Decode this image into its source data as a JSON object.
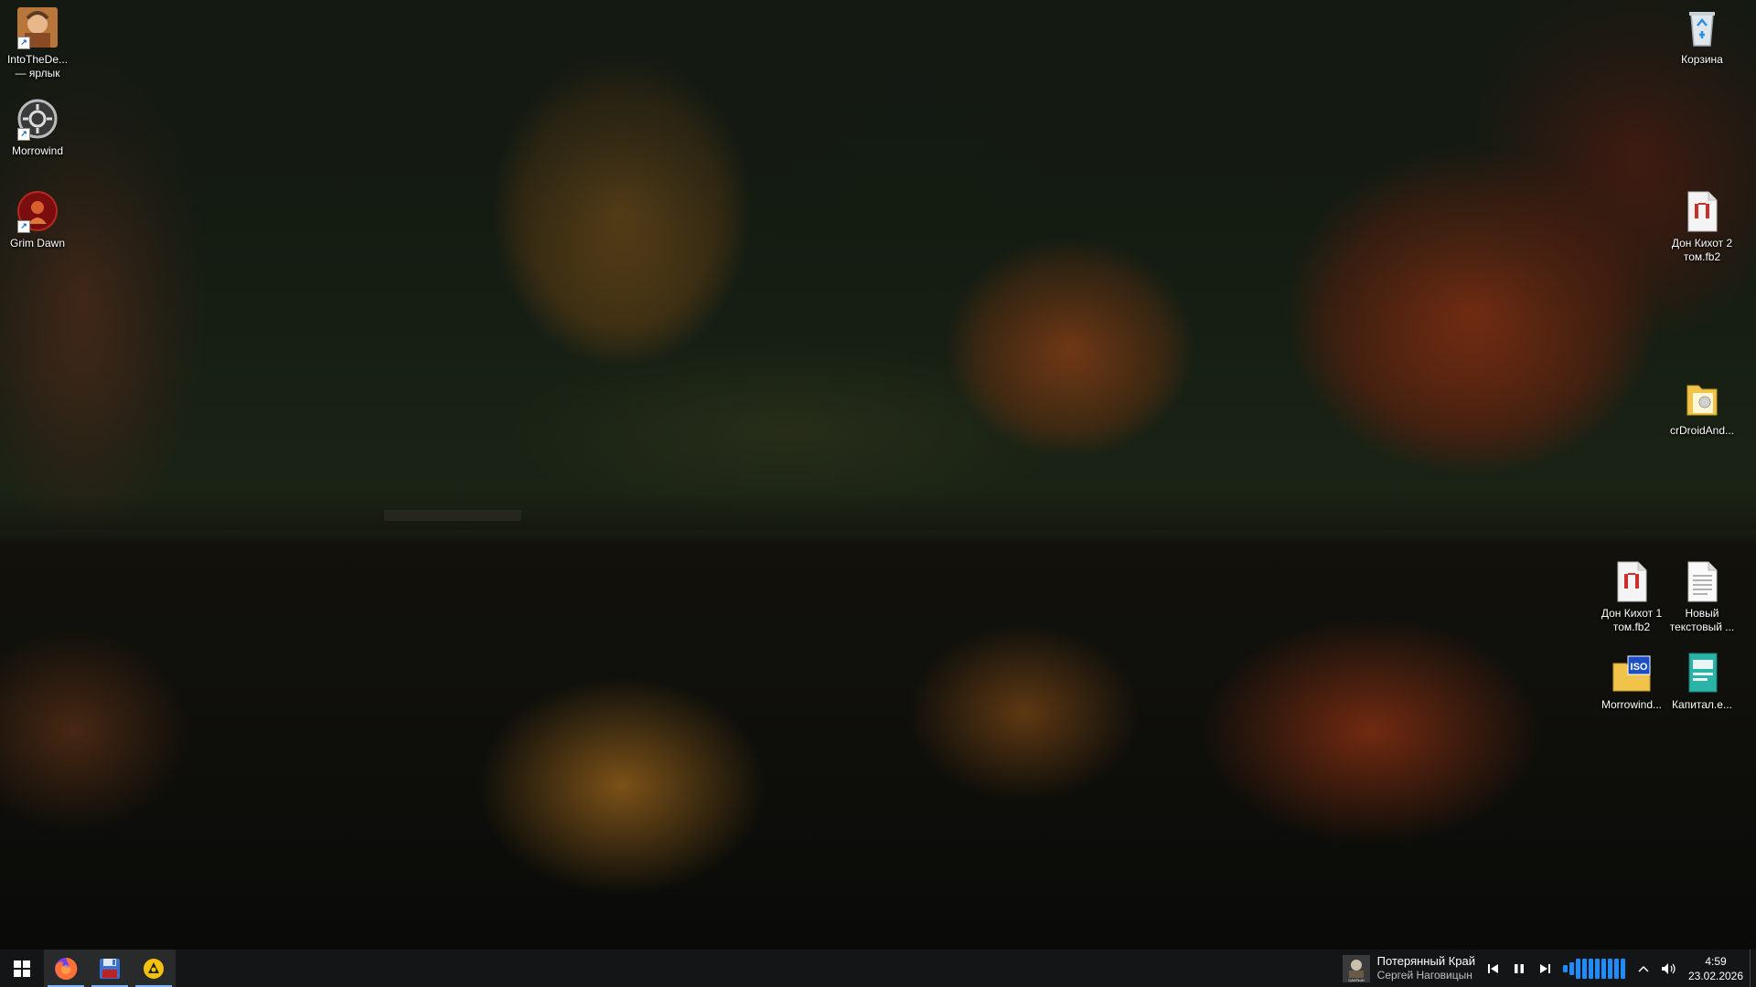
{
  "desktop": {
    "left_icons": [
      {
        "label": "IntoTheDe... — ярлык",
        "icon": "game-portrait-icon"
      },
      {
        "label": "Morrowind",
        "icon": "morrowind-gear-icon"
      },
      {
        "label": "Grim Dawn",
        "icon": "grim-dawn-icon"
      }
    ],
    "right_icons": [
      {
        "label": "Корзина",
        "icon": "recycle-bin-icon"
      },
      {
        "label": "Дон Кихот 2 том.fb2",
        "icon": "fb2-document-icon"
      },
      {
        "label": "crDroidAnd...",
        "icon": "zip-archive-icon"
      },
      {
        "label": "Дон Кихот 1 том.fb2",
        "icon": "fb2-document-icon"
      },
      {
        "label": "Новый текстовый ...",
        "icon": "text-document-icon"
      },
      {
        "label": "Morrowind...",
        "icon": "iso-disc-icon"
      },
      {
        "label": "Капитал.e...",
        "icon": "epub-book-icon"
      }
    ]
  },
  "taskbar": {
    "apps": [
      {
        "name": "start",
        "icon": "windows-start-icon"
      },
      {
        "name": "firefox",
        "icon": "firefox-icon"
      },
      {
        "name": "floppy",
        "icon": "floppy-save-icon"
      },
      {
        "name": "active-app",
        "icon": "yellow-launcher-icon"
      }
    ],
    "media": {
      "title": "Потерянный Край",
      "artist": "Сергей Наговицын",
      "art_label": "САНТЫН"
    },
    "volume_level_bars": 10,
    "clock": {
      "time": "4:59",
      "date": "23.02.2026"
    }
  },
  "colors": {
    "taskbar_bg": "#141618",
    "accent": "#1e8cff"
  }
}
